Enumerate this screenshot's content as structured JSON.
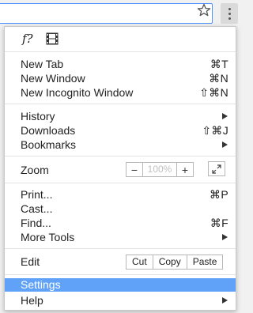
{
  "menu": {
    "group1": [
      {
        "label": "New Tab",
        "shortcut": "⌘T"
      },
      {
        "label": "New Window",
        "shortcut": "⌘N"
      },
      {
        "label": "New Incognito Window",
        "shortcut": "⇧⌘N"
      }
    ],
    "group2": [
      {
        "label": "History",
        "submenu": true
      },
      {
        "label": "Downloads",
        "shortcut": "⇧⌘J"
      },
      {
        "label": "Bookmarks",
        "submenu": true
      }
    ],
    "zoom": {
      "label": "Zoom",
      "minus": "−",
      "value": "100%",
      "plus": "+"
    },
    "group3": [
      {
        "label": "Print...",
        "shortcut": "⌘P"
      },
      {
        "label": "Cast..."
      },
      {
        "label": "Find...",
        "shortcut": "⌘F"
      },
      {
        "label": "More Tools",
        "submenu": true
      }
    ],
    "edit": {
      "label": "Edit",
      "cut": "Cut",
      "copy": "Copy",
      "paste": "Paste"
    },
    "settings": {
      "label": "Settings",
      "selected": true
    },
    "help": {
      "label": "Help",
      "submenu": true
    },
    "extensions": {
      "fx_label": "f?"
    }
  },
  "colors": {
    "selected_bg": "#5fa2f7",
    "omnibox_border": "#4d90fe"
  },
  "icons": [
    "star-icon",
    "more-vert-icon",
    "film-icon",
    "fullscreen-icon"
  ]
}
